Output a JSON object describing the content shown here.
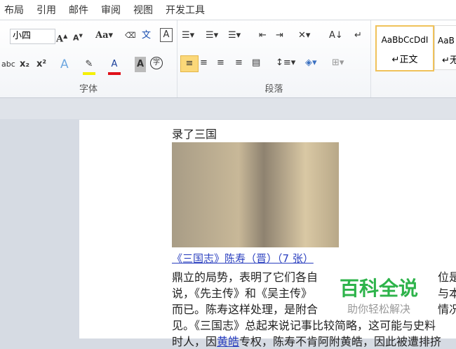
{
  "menu": [
    "布局",
    "引用",
    "邮件",
    "审阅",
    "视图",
    "开发工具"
  ],
  "font": {
    "size": "小四",
    "group_label": "字体"
  },
  "paragraph": {
    "group_label": "段落"
  },
  "styles": [
    {
      "preview": "AaBbCcDdI",
      "name": "↵正文"
    },
    {
      "preview": "AaB",
      "name": "↵无"
    }
  ],
  "doc": {
    "line0": "录了三国",
    "caption": "《三国志》陈寿（晋）（7 张）",
    "lines": [
      {
        "left": "鼎立的局势，表明了它们各自",
        "right": "位是"
      },
      {
        "left": "说，《先主传》和《吴主传》",
        "right": "与本"
      },
      {
        "left": "而已。陈寿这样处理，是附合",
        "right": "情况"
      },
      {
        "left": "见。《三国志》总起来说记事比较简略，这可能与史料",
        "right": ""
      },
      {
        "left": "时人，因",
        "link": "黄皓",
        "rest": "专权，陈寿不肯阿附黄皓，因此被遭排挤"
      }
    ]
  },
  "watermark": {
    "title": "百科全说",
    "subtitle": "助你轻松解决"
  }
}
